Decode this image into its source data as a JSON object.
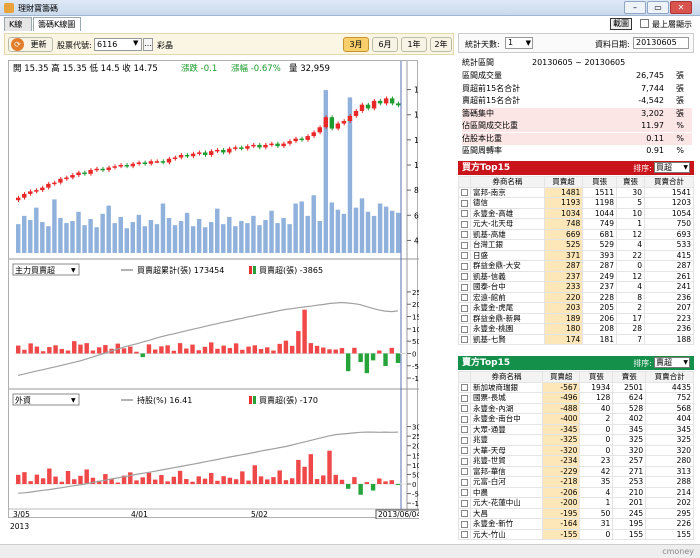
{
  "window": {
    "title": "理財寶籌碼",
    "min": "–",
    "max": "▭",
    "close": "✕",
    "icon": "chart-app-icon"
  },
  "tabs": [
    "K線圖",
    "籌碼K線圖"
  ],
  "top_right": {
    "screen_button": "載圖",
    "always_top": "最上層顯示"
  },
  "toolbar": {
    "refresh": "更新",
    "stock_label": "股票代號:",
    "stock_value": "6116",
    "stock_name": "彩晶",
    "periods": [
      "3月",
      "6月",
      "1年",
      "2年"
    ],
    "active_period": "3月"
  },
  "main_chart": {
    "ohlc": "開 15.35  高 15.35  低 14.5  收 14.75",
    "change": "漲跌 -0.1",
    "change_pct": "漲幅 -0.67%",
    "volume": "量 32,959",
    "yticks": [
      "16",
      "14",
      "12",
      "10",
      "8",
      "6",
      "4"
    ]
  },
  "sub1": {
    "selector": "主力買賣超",
    "legend_line": "買賣超累計(張) 173454",
    "legend_bar": "買賣超(張) -3865",
    "yticks": [
      "25000",
      "20000",
      "15000",
      "10000",
      "5000",
      "0",
      "-5000",
      "-10000"
    ]
  },
  "sub2": {
    "selector": "外資",
    "legend_line": "持股(%) 16.41",
    "legend_bar": "買賣超(張) -170",
    "yticks": [
      "30000",
      "25000",
      "20000",
      "15000",
      "10000",
      "5000",
      "0",
      "-5000",
      "-10000"
    ]
  },
  "xaxis": {
    "labels": [
      "3/05",
      "4/01",
      "5/02"
    ],
    "year": "2013",
    "cursor": "2013/06/04"
  },
  "stats": {
    "days_label": "統計天數:",
    "days_value": "1",
    "date_label": "資料日期:",
    "date_value": "20130605",
    "period_label": "統計區間",
    "period_value": "20130605 ~ 20130605",
    "rows": [
      {
        "k": "區間成交量",
        "v": "26,745",
        "u": "張",
        "pink": false
      },
      {
        "k": "買超前15名合計",
        "v": "7,744",
        "u": "張",
        "pink": false
      },
      {
        "k": "賣超前15名合計",
        "v": "-4,542",
        "u": "張",
        "pink": false
      },
      {
        "k": "籌碼集中",
        "v": "3,202",
        "u": "張",
        "pink": true
      },
      {
        "k": "佔區間成交比重",
        "v": "11.97",
        "u": "%",
        "pink": true
      },
      {
        "k": "佔股本比重",
        "v": "0.11",
        "u": "%",
        "pink": true
      },
      {
        "k": "區間周轉率",
        "v": "0.91",
        "u": "%",
        "pink": false
      }
    ]
  },
  "buy_top": {
    "title": "買方Top15",
    "sort_label": "排序:",
    "sort_value": "買超",
    "color": "#c9141b",
    "headers": [
      "券商名稱",
      "買賣超",
      "買張",
      "賣張",
      "買賣合計"
    ],
    "rows": [
      [
        "富邦-南京",
        "1481",
        "1511",
        "30",
        "1541"
      ],
      [
        "德信",
        "1193",
        "1198",
        "5",
        "1203"
      ],
      [
        "永豐金-高雄",
        "1034",
        "1044",
        "10",
        "1054"
      ],
      [
        "元大-北天母",
        "748",
        "749",
        "1",
        "750"
      ],
      [
        "凱基-高雄",
        "669",
        "681",
        "12",
        "693"
      ],
      [
        "台灣工銀",
        "525",
        "529",
        "4",
        "533"
      ],
      [
        "日盛",
        "371",
        "393",
        "22",
        "415"
      ],
      [
        "群益金鼎-大安",
        "287",
        "287",
        "0",
        "287"
      ],
      [
        "凱基-信義",
        "237",
        "249",
        "12",
        "261"
      ],
      [
        "國泰-台中",
        "233",
        "237",
        "4",
        "241"
      ],
      [
        "宏遠-館前",
        "220",
        "228",
        "8",
        "236"
      ],
      [
        "永豐金-虎尾",
        "203",
        "205",
        "2",
        "207"
      ],
      [
        "群益金鼎-新興",
        "189",
        "206",
        "17",
        "223"
      ],
      [
        "永豐金-桃園",
        "180",
        "208",
        "28",
        "236"
      ],
      [
        "凱基-七賢",
        "174",
        "181",
        "7",
        "188"
      ]
    ]
  },
  "sell_top": {
    "title": "賣方Top15",
    "sort_label": "排序:",
    "sort_value": "賣超",
    "color": "#14904a",
    "headers": [
      "券商名稱",
      "買賣超",
      "買張",
      "賣張",
      "買賣合計"
    ],
    "rows": [
      [
        "新加坡商瑞銀",
        "-567",
        "1934",
        "2501",
        "4435"
      ],
      [
        "國票-長城",
        "-496",
        "128",
        "624",
        "752"
      ],
      [
        "永豐金-內湖",
        "-488",
        "40",
        "528",
        "568"
      ],
      [
        "永豐金-南台中",
        "-400",
        "2",
        "402",
        "404"
      ],
      [
        "大眾-通豐",
        "-345",
        "0",
        "345",
        "345"
      ],
      [
        "兆豐",
        "-325",
        "0",
        "325",
        "325"
      ],
      [
        "大華-天母",
        "-320",
        "0",
        "320",
        "320"
      ],
      [
        "兆豐-世貿",
        "-234",
        "23",
        "257",
        "280"
      ],
      [
        "富邦-華信",
        "-229",
        "42",
        "271",
        "313"
      ],
      [
        "元富-白河",
        "-218",
        "35",
        "253",
        "288"
      ],
      [
        "中農",
        "-206",
        "4",
        "210",
        "214"
      ],
      [
        "元大-花蓮中山",
        "-200",
        "1",
        "201",
        "202"
      ],
      [
        "大昌",
        "-195",
        "50",
        "245",
        "295"
      ],
      [
        "永豐金-新竹",
        "-164",
        "31",
        "195",
        "226"
      ],
      [
        "元大-竹山",
        "-155",
        "0",
        "155",
        "155"
      ]
    ]
  },
  "status": "cmoney",
  "chart_data": [
    {
      "type": "candlestick",
      "title": "",
      "ylim": [
        3,
        17
      ],
      "closes": [
        7.4,
        7.7,
        7.9,
        8.0,
        8.2,
        8.5,
        8.6,
        8.9,
        9.0,
        9.2,
        9.4,
        9.3,
        9.6,
        9.7,
        9.6,
        9.8,
        9.9,
        10.0,
        9.9,
        10.1,
        10.2,
        10.1,
        10.3,
        10.3,
        10.2,
        10.5,
        10.6,
        10.8,
        10.7,
        10.9,
        11.0,
        10.8,
        11.1,
        11.2,
        11.0,
        11.3,
        11.4,
        11.3,
        11.5,
        11.6,
        11.4,
        11.6,
        11.7,
        11.5,
        11.7,
        11.9,
        12.1,
        12.0,
        12.3,
        12.6,
        13.0,
        13.8,
        12.9,
        13.3,
        13.5,
        13.9,
        14.3,
        14.8,
        14.5,
        15.1,
        14.9,
        15.3,
        14.9,
        14.75
      ],
      "volumes": [
        2.8,
        3.6,
        3.2,
        4.4,
        3.0,
        2.6,
        5.2,
        3.4,
        2.9,
        3.1,
        4.0,
        2.7,
        3.3,
        2.5,
        3.8,
        4.6,
        2.9,
        3.5,
        2.4,
        3.0,
        3.7,
        2.6,
        3.2,
        2.8,
        4.8,
        3.4,
        2.7,
        3.1,
        3.9,
        2.6,
        3.3,
        2.5,
        3.0,
        4.3,
        2.8,
        3.5,
        2.6,
        3.1,
        2.9,
        3.6,
        2.7,
        3.2,
        4.1,
        2.9,
        3.4,
        2.8,
        4.8,
        5.0,
        3.6,
        5.6,
        3.1,
        15.8,
        4.9,
        4.2,
        3.8,
        15.1,
        4.4,
        5.3,
        4.0,
        3.6,
        4.8,
        4.5,
        4.1,
        3.9
      ]
    },
    {
      "type": "bar",
      "title": "主力買賣超",
      "series": [
        {
          "name": "買賣超(張)",
          "values": [
            3200,
            1500,
            4100,
            2800,
            900,
            2600,
            3300,
            1800,
            1200,
            5000,
            3600,
            4200,
            1200,
            2500,
            3400,
            1900,
            4000,
            2100,
            2800,
            700,
            -1500,
            3700,
            1600,
            2900,
            3300,
            1100,
            4200,
            2000,
            3600,
            1300,
            2700,
            4500,
            1900,
            3200,
            2200,
            4100,
            1500,
            2800,
            3300,
            1800,
            2500,
            1200,
            3900,
            5200,
            3100,
            9100,
            17800,
            4200,
            3100,
            2400,
            1700,
            1600,
            2200,
            -7200,
            2300,
            -3500,
            -8000,
            -2800,
            1200,
            -5100,
            2300,
            -3865
          ]
        },
        {
          "name": "買賣超累計(張)",
          "values": [
            -8900,
            -8300,
            -7700,
            -7100,
            -6600,
            -6000,
            -5400,
            -4800,
            -4200,
            -3600,
            -3000,
            -2200,
            -1400,
            -600,
            200,
            1000,
            1800,
            2600,
            3300,
            3900,
            4600,
            5300,
            6100,
            6800,
            7400,
            8000,
            8600,
            9200,
            9800,
            10400,
            11000,
            11600,
            12100,
            12700,
            13200,
            13800,
            14300,
            14900,
            15400,
            15900,
            16400,
            16900,
            17400,
            17900,
            18200,
            18600,
            18900,
            19200,
            19600,
            19900,
            20300,
            20500,
            20700,
            20500,
            20200,
            19800,
            19000,
            18300,
            17600,
            17200,
            17000,
            17300
          ]
        }
      ],
      "ylim": [
        -12000,
        27000
      ]
    },
    {
      "type": "bar",
      "title": "外資",
      "series": [
        {
          "name": "買賣超(張)",
          "values": [
            4800,
            6200,
            1500,
            4900,
            3000,
            8100,
            3900,
            1200,
            6800,
            2500,
            4300,
            7600,
            3300,
            1700,
            5200,
            2900,
            800,
            4400,
            6100,
            1900,
            3500,
            5900,
            2300,
            4700,
            1400,
            3800,
            6900,
            2600,
            1200,
            4000,
            2800,
            5800,
            1700,
            4100,
            3300,
            2500,
            6600,
            1800,
            9800,
            4000,
            2400,
            3600,
            7100,
            2000,
            3000,
            12600,
            9000,
            15600,
            2600,
            4500,
            17400,
            4800,
            2200,
            -2500,
            3600,
            -5600,
            1000,
            -3400,
            2900,
            1400,
            2000,
            -170
          ]
        },
        {
          "name": "持股(%)",
          "values": [
            -4800,
            -4600,
            -4200,
            -3700,
            -3300,
            -2900,
            -2400,
            -1900,
            -1400,
            -900,
            -400,
            200,
            800,
            1400,
            2000,
            2600,
            3200,
            3800,
            4400,
            5000,
            5600,
            6100,
            6700,
            7300,
            7900,
            8500,
            9100,
            9700,
            10300,
            10900,
            11600,
            12200,
            12800,
            13500,
            14100,
            14700,
            15300,
            15900,
            16500,
            17200,
            17800,
            18400,
            19000,
            19600,
            20400,
            21200,
            22000,
            22800,
            23600,
            24400,
            25200,
            25800,
            26100,
            26400,
            26700,
            27000,
            27100,
            27100,
            27000,
            27100,
            27000,
            27100
          ]
        }
      ],
      "ylim": [
        -12000,
        35000
      ]
    }
  ]
}
